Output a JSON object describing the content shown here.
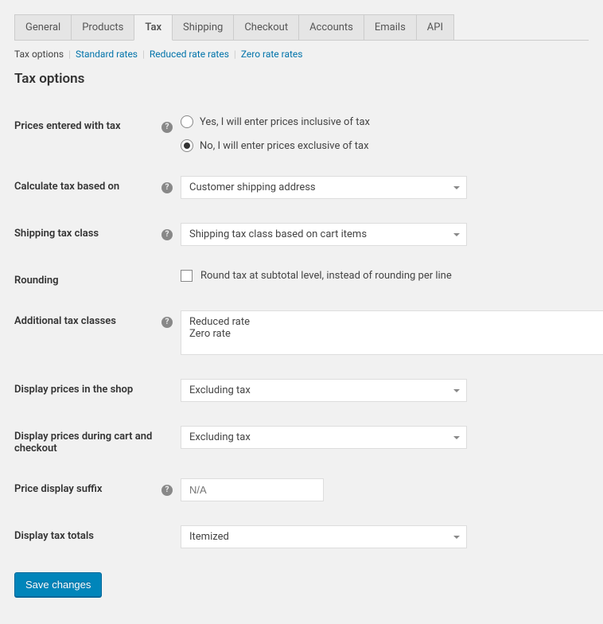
{
  "tabs": [
    {
      "label": "General"
    },
    {
      "label": "Products"
    },
    {
      "label": "Tax",
      "active": true
    },
    {
      "label": "Shipping"
    },
    {
      "label": "Checkout"
    },
    {
      "label": "Accounts"
    },
    {
      "label": "Emails"
    },
    {
      "label": "API"
    }
  ],
  "subtabs": {
    "active": "Tax options",
    "links": [
      "Standard rates",
      "Reduced rate rates",
      "Zero rate rates"
    ]
  },
  "section_title": "Tax options",
  "fields": {
    "prices_with_tax": {
      "label": "Prices entered with tax",
      "options": [
        "Yes, I will enter prices inclusive of tax",
        "No, I will enter prices exclusive of tax"
      ],
      "selected": 1
    },
    "calc_based": {
      "label": "Calculate tax based on",
      "value": "Customer shipping address"
    },
    "ship_class": {
      "label": "Shipping tax class",
      "value": "Shipping tax class based on cart items"
    },
    "rounding": {
      "label": "Rounding",
      "checkbox_label": "Round tax at subtotal level, instead of rounding per line",
      "checked": false
    },
    "add_classes": {
      "label": "Additional tax classes",
      "value": "Reduced rate\nZero rate"
    },
    "display_shop": {
      "label": "Display prices in the shop",
      "value": "Excluding tax"
    },
    "display_cart": {
      "label": "Display prices during cart and checkout",
      "value": "Excluding tax"
    },
    "suffix": {
      "label": "Price display suffix",
      "placeholder": "N/A"
    },
    "totals": {
      "label": "Display tax totals",
      "value": "Itemized"
    }
  },
  "save_label": "Save changes"
}
